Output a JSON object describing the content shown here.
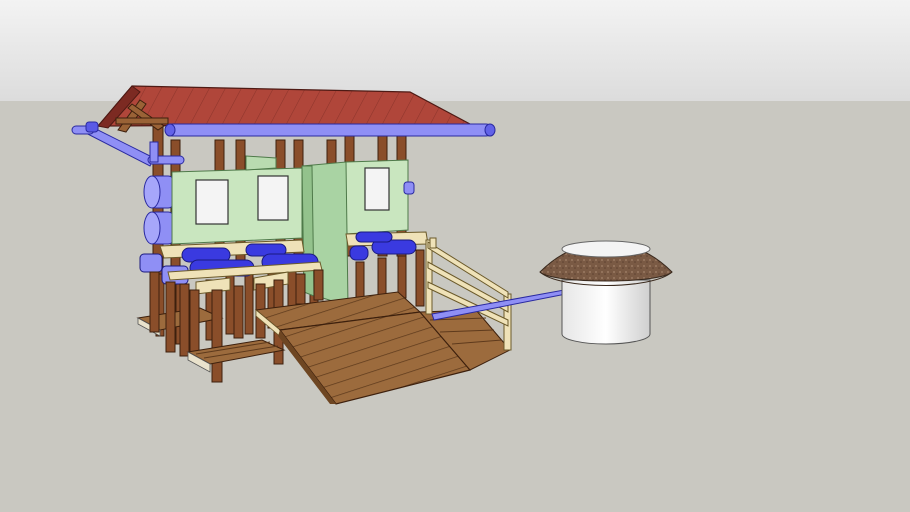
{
  "scene": {
    "description_visible_text": [],
    "colors": {
      "sky_top": "#f0f0f0",
      "sky_bottom": "#d8d8d8",
      "ground": "#c8c7c0",
      "roof": "#b0463a",
      "roof_dark": "#7c2a22",
      "wall_green": "#c9e6bf",
      "wall_green_dark": "#a8cfa0",
      "window": "#f2f2f2",
      "post": "#8a4e2a",
      "post_dark": "#5e3318",
      "deck": "#9b6a3c",
      "deck_dark": "#6e4622",
      "rail_light": "#efe2b8",
      "pipe": "#8f8ff5",
      "pipe_dark": "#4d4dd8",
      "tank_blue": "#3a3ae0",
      "tank_body": "#f4f4f4",
      "tank_roof": "#7a5a44"
    }
  }
}
